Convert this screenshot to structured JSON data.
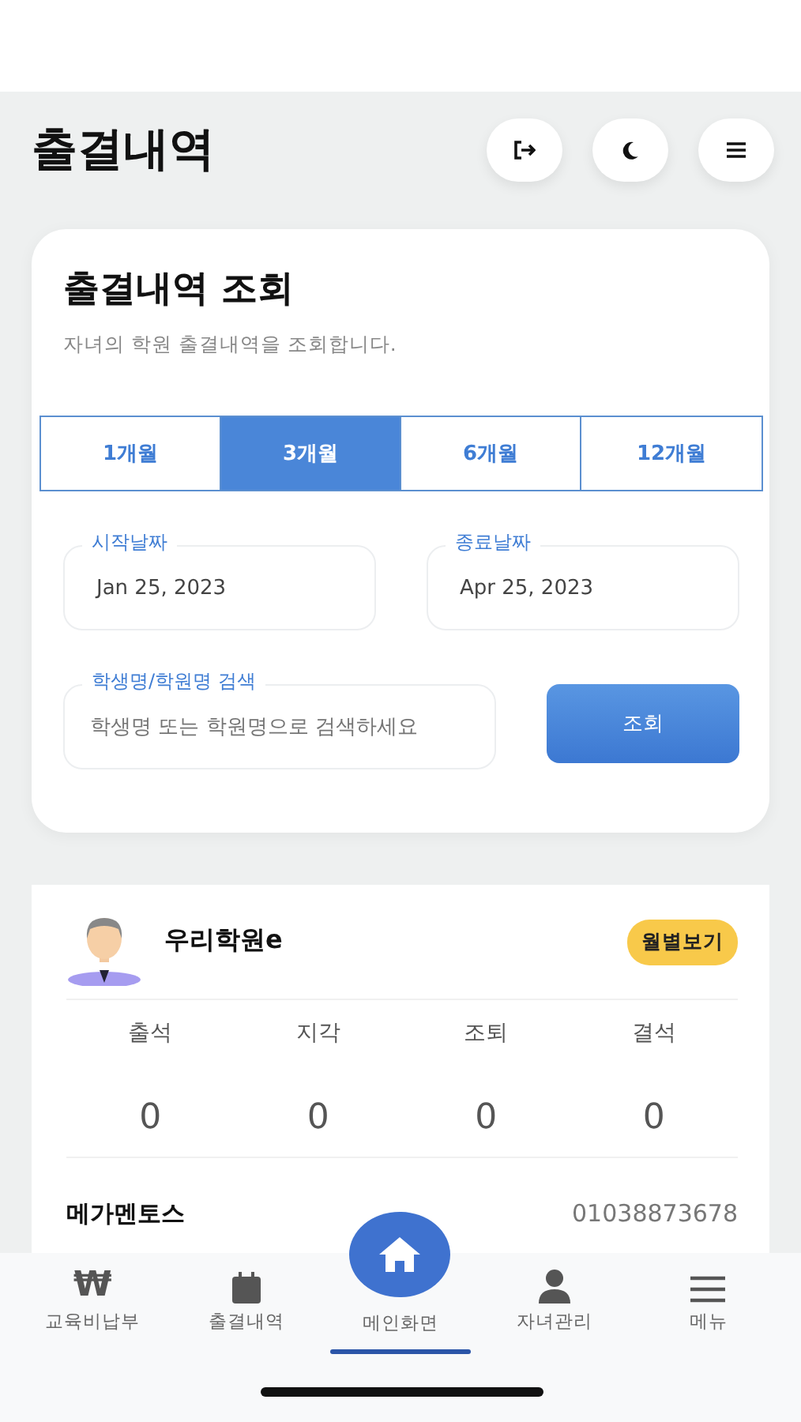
{
  "header": {
    "title": "출결내역"
  },
  "query": {
    "title": "출결내역 조회",
    "subtitle": "자녀의 학원 출결내역을 조회합니다.",
    "periods": [
      {
        "label": "1개월",
        "selected": false
      },
      {
        "label": "3개월",
        "selected": true
      },
      {
        "label": "6개월",
        "selected": false
      },
      {
        "label": "12개월",
        "selected": false
      }
    ],
    "start_date": {
      "label": "시작날짜",
      "value": "Jan 25, 2023"
    },
    "end_date": {
      "label": "종료날짜",
      "value": "Apr 25, 2023"
    },
    "search": {
      "label": "학생명/학원명 검색",
      "placeholder": "학생명 또는 학원명으로 검색하세요"
    },
    "submit": "조회"
  },
  "academy": {
    "name": "우리학원e",
    "badge": "월별보기",
    "stats": [
      {
        "label": "출석",
        "value": "0"
      },
      {
        "label": "지각",
        "value": "0"
      },
      {
        "label": "조퇴",
        "value": "0"
      },
      {
        "label": "결석",
        "value": "0"
      }
    ],
    "info": {
      "label": "메가멘토스",
      "value": "01038873678"
    }
  },
  "nav": [
    {
      "icon": "₩",
      "label": "교육비납부",
      "selected": false
    },
    {
      "label": "출결내역",
      "selected": false
    },
    {
      "label": "메인화면",
      "selected": true
    },
    {
      "label": "자녀관리",
      "selected": false
    },
    {
      "label": "메뉴",
      "selected": false
    }
  ]
}
